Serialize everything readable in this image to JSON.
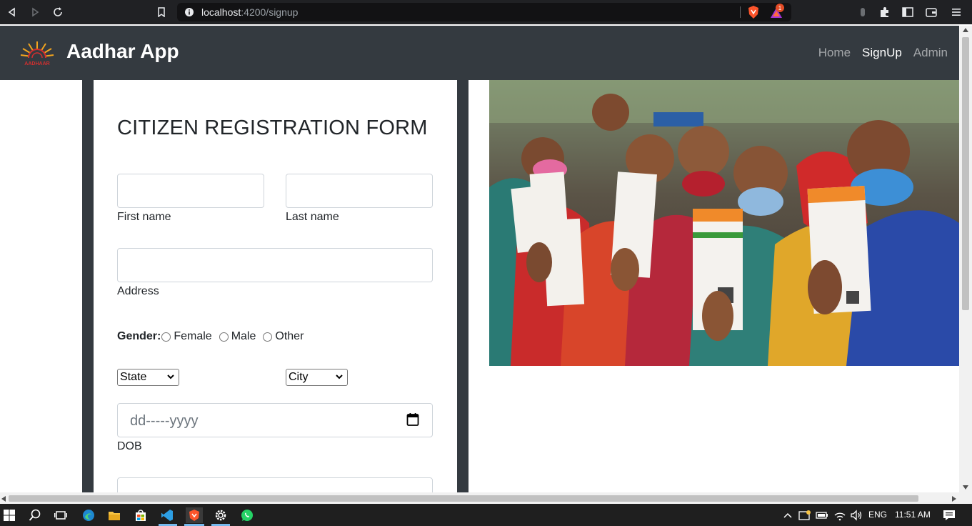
{
  "browser": {
    "url_host": "localhost",
    "url_path": ":4200/signup",
    "notification_count": "1"
  },
  "navbar": {
    "brand_title": "Aadhar App",
    "logo_text": "AADHAAR",
    "links": [
      {
        "label": "Home",
        "active": false
      },
      {
        "label": "SignUp",
        "active": true
      },
      {
        "label": "Admin",
        "active": false
      }
    ]
  },
  "form": {
    "title": "CITIZEN REGISTRATION FORM",
    "first_name_label": "First name",
    "last_name_label": "Last name",
    "address_label": "Address",
    "gender_label": "Gender:",
    "gender_options": [
      "Female",
      "Male",
      "Other"
    ],
    "state_select": "State",
    "city_select": "City",
    "dob_placeholder": "dd-----yyyy",
    "dob_label": "DOB"
  },
  "taskbar": {
    "language": "ENG",
    "time": "11:51 AM"
  },
  "colors": {
    "navbar_bg": "#343a40",
    "chrome_bg": "#202124",
    "taskbar_bg": "#1f1f1f"
  }
}
